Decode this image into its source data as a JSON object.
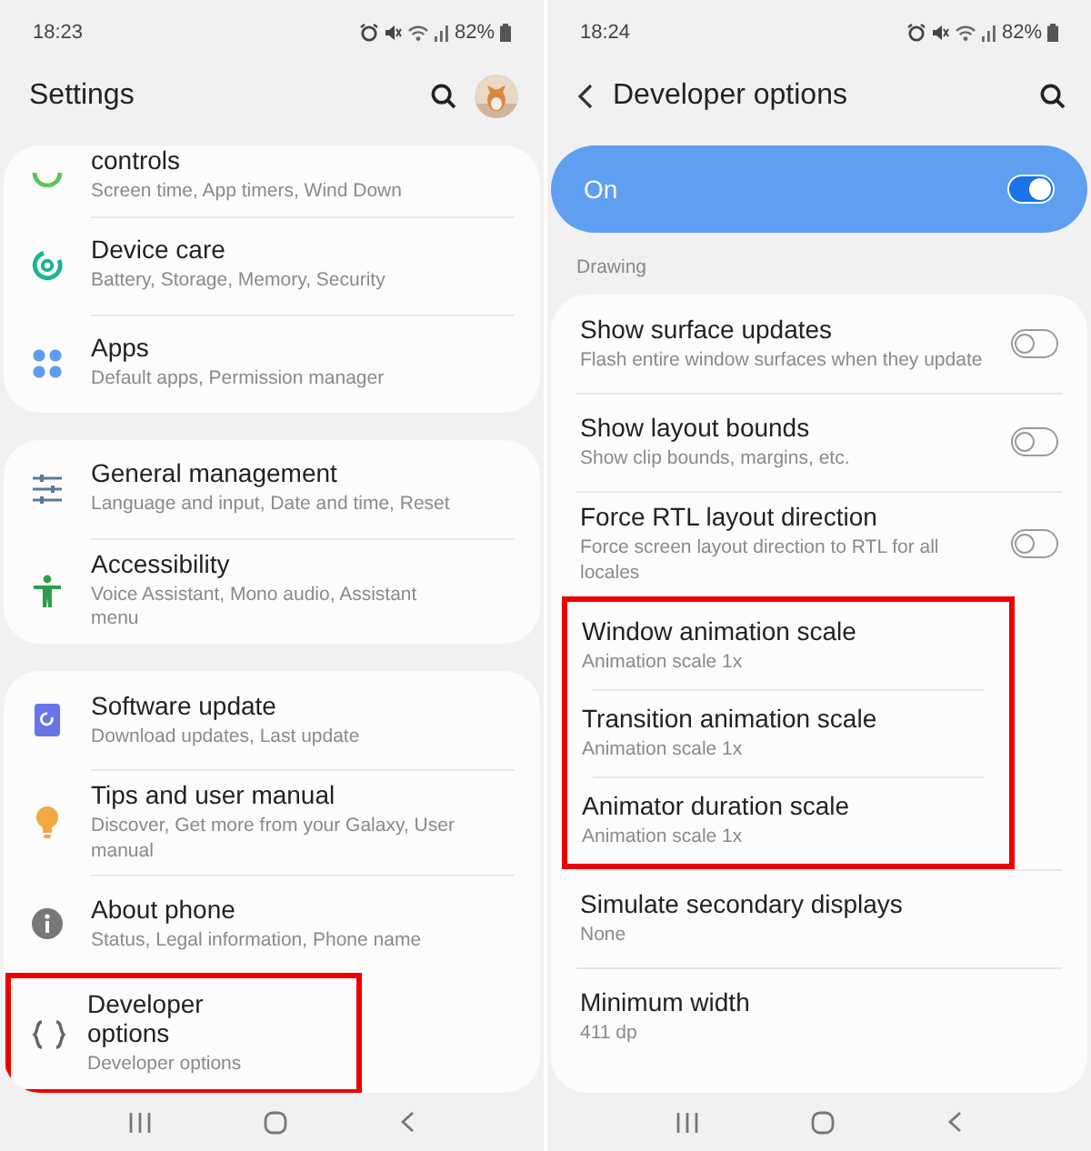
{
  "screens": [
    {
      "status_bar": {
        "time": "18:23",
        "battery": "82%"
      },
      "header": {
        "title": "Settings",
        "search": true
      },
      "cards": [
        {
          "items": [
            {
              "kind": "link",
              "title": "controls",
              "subtitle": "Screen time, App timers, Wind Down",
              "highlighted": false
            },
            {
              "kind": "link",
              "title": "Device care",
              "subtitle": "Battery, Storage, Memory, Security",
              "highlighted": false
            },
            {
              "kind": "link",
              "title": "Apps",
              "subtitle": "Default apps, Permission manager",
              "highlighted": false
            }
          ]
        },
        {
          "items": [
            {
              "kind": "link",
              "title": "General management",
              "subtitle": "Language and input, Date and time, Reset",
              "highlighted": false
            },
            {
              "kind": "link",
              "title": "Accessibility",
              "subtitle": "Voice Assistant, Mono audio, Assistant menu",
              "highlighted": false
            }
          ]
        },
        {
          "items": [
            {
              "kind": "link",
              "title": "Software update",
              "subtitle": "Download updates, Last update",
              "highlighted": false
            },
            {
              "kind": "link",
              "title": "Tips and user manual",
              "subtitle": "Discover, Get more from your Galaxy, User manual",
              "highlighted": false
            },
            {
              "kind": "link",
              "title": "About phone",
              "subtitle": "Status, Legal information, Phone name",
              "highlighted": false
            },
            {
              "kind": "link",
              "title": "Developer options",
              "subtitle": "Developer options",
              "highlighted": true
            }
          ]
        }
      ]
    },
    {
      "status_bar": {
        "time": "18:24",
        "battery": "82%"
      },
      "header": {
        "title": "Developer options",
        "back": true,
        "search": true
      },
      "master_switch": {
        "label": "On",
        "on": true
      },
      "section": "Drawing",
      "cards": [
        {
          "items": [
            {
              "kind": "toggle",
              "title": "Show surface updates",
              "subtitle": "Flash entire window surfaces when they update",
              "on": false,
              "highlighted": false
            },
            {
              "kind": "toggle",
              "title": "Show layout bounds",
              "subtitle": "Show clip bounds, margins, etc.",
              "on": false,
              "highlighted": false
            },
            {
              "kind": "toggle",
              "title": "Force RTL layout direction",
              "subtitle": "Force screen layout direction to RTL for all locales",
              "on": false,
              "highlighted": false
            },
            {
              "kind": "value",
              "title": "Window animation scale",
              "subtitle": "Animation scale 1x",
              "highlighted": true
            },
            {
              "kind": "value",
              "title": "Transition animation scale",
              "subtitle": "Animation scale 1x",
              "highlighted": true
            },
            {
              "kind": "value",
              "title": "Animator duration scale",
              "subtitle": "Animation scale 1x",
              "highlighted": true
            },
            {
              "kind": "value",
              "title": "Simulate secondary displays",
              "subtitle": "None",
              "highlighted": false
            },
            {
              "kind": "value",
              "title": "Minimum width",
              "subtitle": "411 dp",
              "highlighted": false
            }
          ]
        }
      ]
    }
  ]
}
